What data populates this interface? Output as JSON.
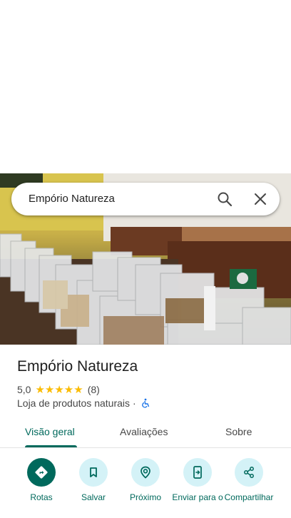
{
  "search": {
    "query": "Empório Natureza"
  },
  "place": {
    "name": "Empório Natureza",
    "rating": "5,0",
    "stars": "★★★★★",
    "review_count": "(8)",
    "category": "Loja de produtos naturais",
    "separator": "·"
  },
  "tabs": [
    {
      "label": "Visão geral",
      "active": true
    },
    {
      "label": "Avaliações",
      "active": false
    },
    {
      "label": "Sobre",
      "active": false
    }
  ],
  "actions": [
    {
      "label": "Rotas",
      "icon": "directions-icon"
    },
    {
      "label": "Salvar",
      "icon": "bookmark-icon"
    },
    {
      "label": "Próximo",
      "icon": "nearby-icon"
    },
    {
      "label": "Enviar para o",
      "icon": "send-to-phone-icon"
    },
    {
      "label": "Compartilhar",
      "icon": "share-icon"
    }
  ],
  "colors": {
    "accent": "#00695c",
    "action_bg": "#d4f2f7",
    "star": "#fbbc04",
    "text_secondary": "#474747"
  }
}
